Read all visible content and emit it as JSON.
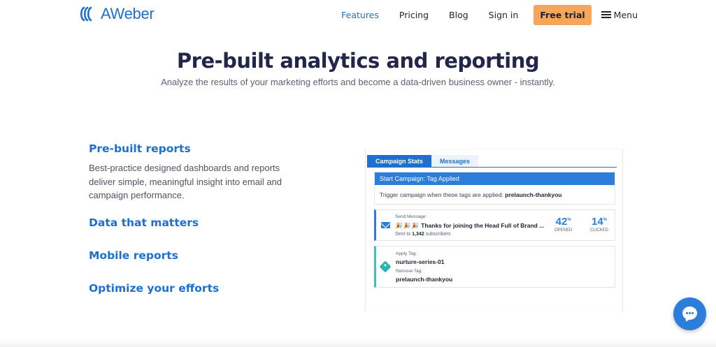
{
  "header": {
    "logo_text": "AWeber",
    "nav": {
      "features": "Features",
      "pricing": "Pricing",
      "blog": "Blog",
      "sign_in": "Sign in",
      "free_trial": "Free trial",
      "menu": "Menu"
    }
  },
  "hero": {
    "title": "Pre-built analytics and reporting",
    "subtitle": "Analyze the results of your marketing efforts and become a data-driven business owner - instantly."
  },
  "features": [
    {
      "title": "Pre-built reports",
      "description": "Best-practice designed dashboards and reports deliver simple, meaningful insight into email and campaign performance."
    },
    {
      "title": "Data that matters"
    },
    {
      "title": "Mobile reports"
    },
    {
      "title": "Optimize your efforts"
    }
  ],
  "panel": {
    "tabs": [
      "Campaign Stats",
      "Messages"
    ],
    "start_campaign": {
      "header": "Start Campaign: Tag Applied",
      "trigger_text": "Trigger campaign when these tags are applied:",
      "trigger_tag": "prelaunch-thankyou"
    },
    "send_message": {
      "label": "Send Message:",
      "emoji": "🎉🎉🎉",
      "subject": "Thanks for joining the Head Full of Brand ...",
      "sent_prefix": "Sent to",
      "sent_count": "1,342",
      "sent_suffix": "subscribers",
      "opened_value": "42",
      "opened_label": "OPENED",
      "clicked_value": "14",
      "clicked_label": "CLICKED",
      "percent": "%"
    },
    "apply_tag": {
      "apply_label": "Apply Tag:",
      "apply_value": "nurture-series-01",
      "remove_label": "Remove Tag:",
      "remove_value": "prelaunch-thankyou"
    }
  },
  "colors": {
    "brand_blue": "#1d6fd0",
    "cta_orange": "#f5a65b",
    "teal": "#3cbfbf"
  },
  "icons": [
    "aweber-logo-icon",
    "menu-icon",
    "mail-icon",
    "tag-icon",
    "chat-icon"
  ]
}
